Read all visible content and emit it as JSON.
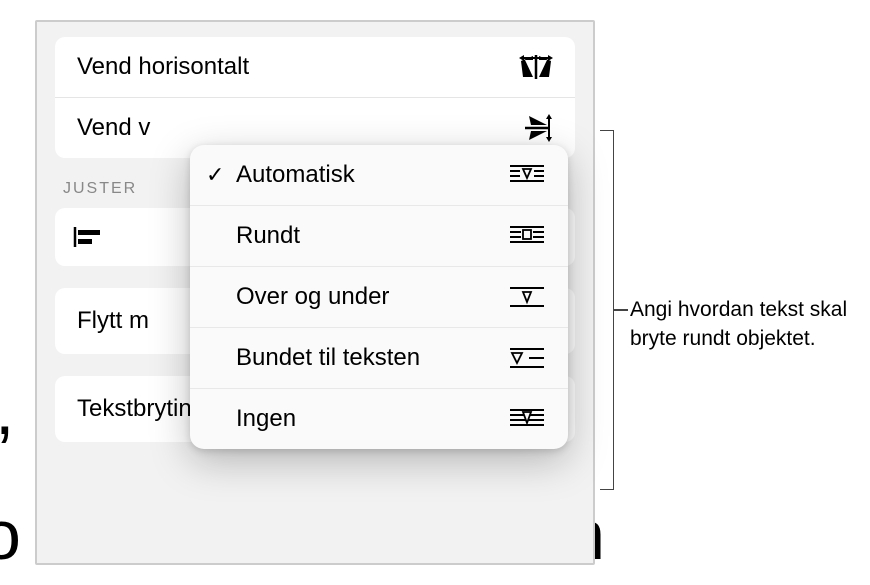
{
  "flip": {
    "horizontal": "Vend horisontalt",
    "vertical": "Vend v"
  },
  "section": {
    "align": "JUSTER"
  },
  "move": "Flytt m",
  "wrap": {
    "label": "Tekstbryting",
    "value": "Automatisk"
  },
  "popup": {
    "items": [
      {
        "label": "Automatisk",
        "checked": true,
        "icon": "wrap-auto"
      },
      {
        "label": "Rundt",
        "checked": false,
        "icon": "wrap-around"
      },
      {
        "label": "Over og under",
        "checked": false,
        "icon": "wrap-topbottom"
      },
      {
        "label": "Bundet til teksten",
        "checked": false,
        "icon": "wrap-inline"
      },
      {
        "label": "Ingen",
        "checked": false,
        "icon": "wrap-none"
      }
    ]
  },
  "annotation": "Angi hvordan tekst skal bryte rundt objektet.",
  "bg": {
    "comma": ",",
    "left": "o",
    "right": "n"
  }
}
